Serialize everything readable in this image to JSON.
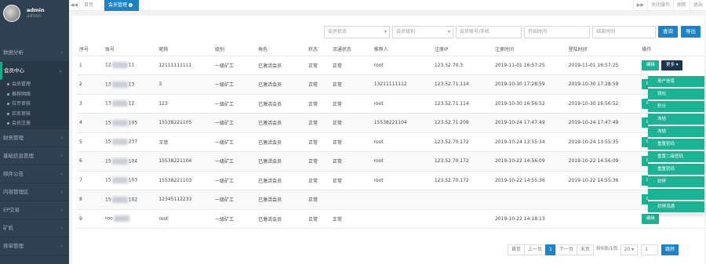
{
  "user": {
    "name": "admin",
    "role": "admin"
  },
  "sidebar": {
    "items": [
      {
        "label": "数据分析",
        "active": false
      },
      {
        "label": "会员中心",
        "active": true
      },
      {
        "label": "财务管理",
        "active": false
      },
      {
        "label": "基础信息管理",
        "active": false
      },
      {
        "label": "邮件公告",
        "active": false
      },
      {
        "label": "内容管理区",
        "active": false
      },
      {
        "label": "EP交易",
        "active": false
      },
      {
        "label": "矿机",
        "active": false
      },
      {
        "label": "排单管理",
        "active": false
      }
    ],
    "subitems": [
      "会员管理",
      "推荐网络",
      "拉币审核",
      "实名审核",
      "会员注册"
    ]
  },
  "topbar": {
    "back": "◀◀",
    "home_tab": "首页",
    "current_tab": "会员管理",
    "forward": "▶▶",
    "actions": [
      "关闭操作",
      "刷新",
      "退出"
    ]
  },
  "filters": {
    "status_placeholder": "会员状态",
    "level_placeholder": "会员级别",
    "account_placeholder": "会员账号/手机",
    "start_placeholder": "开始时间",
    "end_placeholder": "结束时间",
    "search_label": "查询",
    "export_label": "导出"
  },
  "table": {
    "headers": [
      "序号",
      "账号",
      "昵称",
      "级别",
      "角色",
      "状态",
      "流通状态",
      "推荐人",
      "注册IP",
      "注册时间",
      "登陆时间",
      "操作"
    ],
    "rows": [
      {
        "no": "1",
        "acc_a": "12",
        "acc_b": "11",
        "nick": "12111111111",
        "level": "一级矿工",
        "role": "已激活会员",
        "status": "正常",
        "flow": "正常",
        "ref": "root",
        "ip": "123.52.70.3",
        "reg": "2019-11-01 16:57:25",
        "login": "2019-11-01 16:57:25"
      },
      {
        "no": "2",
        "acc_a": "13",
        "acc_b": "13",
        "nick": "3",
        "level": "一级矿工",
        "role": "已激活会员",
        "status": "正常",
        "flow": "正常",
        "ref": "13211111112",
        "ip": "123.52.71.114",
        "reg": "2019-10-30 17:28:59",
        "login": "2019-10-30 17:28:59"
      },
      {
        "no": "3",
        "acc_a": "13",
        "acc_b": "12",
        "nick": "123",
        "level": "一级矿工",
        "role": "已激活会员",
        "status": "正常",
        "flow": "正常",
        "ref": "root",
        "ip": "123.52.71.114",
        "reg": "2019-10-30 16:56:52",
        "login": "2019-10-30 16:56:52"
      },
      {
        "no": "4",
        "acc_a": "15",
        "acc_b": "105",
        "nick": "15538221105",
        "level": "一级矿工",
        "role": "已激活会员",
        "status": "正常",
        "flow": "正常",
        "ref": "15538221104",
        "ip": "123.52.71.209",
        "reg": "2019-10-24 17:47:49",
        "login": "2019-10-24 17:47:49"
      },
      {
        "no": "5",
        "acc_a": "15",
        "acc_b": "237",
        "nick": "王菲",
        "level": "一级矿工",
        "role": "已激活会员",
        "status": "正常",
        "flow": "正常",
        "ref": "root",
        "ip": "123.52.70.172",
        "reg": "2019-10-24 13:55:34",
        "login": "2019-10-24 13:55:35"
      },
      {
        "no": "6",
        "acc_a": "15",
        "acc_b": "104",
        "nick": "15538221104",
        "level": "一级矿工",
        "role": "已激活会员",
        "status": "正常",
        "flow": "正常",
        "ref": "root",
        "ip": "123.52.70.172",
        "reg": "2019-10-22 14:56:09",
        "login": "2019-10-22 14:56:09"
      },
      {
        "no": "7",
        "acc_a": "15",
        "acc_b": "103",
        "nick": "15538221103",
        "level": "一级矿工",
        "role": "已激活会员",
        "status": "正常",
        "flow": "正常",
        "ref": "root",
        "ip": "123.52.70.172",
        "reg": "2019-10-22 14:55:36",
        "login": "2019-10-22 14:55:36"
      },
      {
        "no": "8",
        "acc_a": "15",
        "acc_b": "102",
        "nick": "12345112233",
        "level": "一级矿工",
        "role": "已激活会员",
        "status": "正常",
        "flow": "",
        "ref": "",
        "ip": "",
        "reg": "",
        "login": ""
      },
      {
        "no": "9",
        "acc_a": "roo",
        "acc_b": "",
        "nick": "root",
        "level": "一级矿工",
        "role": "已激活会员",
        "status": "正常",
        "flow": "正常",
        "ref": "",
        "ip": "",
        "reg": "2019-10-22 14:18:13",
        "login": ""
      }
    ],
    "edit_label": "编辑",
    "more_label": "更多"
  },
  "dropdown": [
    "用户信息",
    "钱包",
    "积分",
    "冻结",
    "冻结",
    "重置密码",
    "重置二级密码",
    "重置密码",
    "封停",
    "",
    "封停流通"
  ],
  "pager": {
    "first": "首页",
    "prev": "上一页",
    "current": "1",
    "next": "下一页",
    "last": "末页",
    "total": "共9条/1页",
    "size": "20",
    "jump_value": "1",
    "jump_label": "跳转"
  }
}
